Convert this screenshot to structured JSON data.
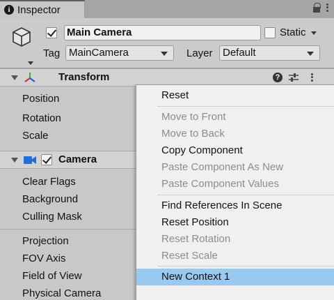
{
  "tab": {
    "label": "Inspector"
  },
  "header": {
    "object_name": "Main Camera",
    "active": true,
    "static_label": "Static",
    "static_checked": false,
    "tag_label": "Tag",
    "tag_value": "MainCamera",
    "layer_label": "Layer",
    "layer_value": "Default"
  },
  "transform": {
    "title": "Transform",
    "properties": [
      "Position",
      "Rotation",
      "Scale"
    ]
  },
  "camera": {
    "title": "Camera",
    "enabled": true,
    "properties": [
      "Clear Flags",
      "Background",
      "Culling Mask",
      "Projection",
      "FOV Axis",
      "Field of View",
      "Physical Camera"
    ]
  },
  "context_menu": {
    "items": [
      {
        "label": "Reset",
        "enabled": true
      },
      {
        "label": "Move to Front",
        "enabled": false
      },
      {
        "label": "Move to Back",
        "enabled": false
      },
      {
        "label": "Copy Component",
        "enabled": true
      },
      {
        "label": "Paste Component As New",
        "enabled": false
      },
      {
        "label": "Paste Component Values",
        "enabled": false
      },
      {
        "label": "Find References In Scene",
        "enabled": true
      },
      {
        "label": "Reset Position",
        "enabled": true
      },
      {
        "label": "Reset Rotation",
        "enabled": false
      },
      {
        "label": "Reset Scale",
        "enabled": false
      },
      {
        "label": "New Context 1",
        "enabled": true,
        "highlighted": true
      }
    ]
  },
  "colors": {
    "highlight": "#99c9ef",
    "camera_icon": "#1f6fd6",
    "axis_red": "#d62b2b",
    "axis_green": "#3aa83a",
    "axis_blue": "#2a5bd6"
  }
}
